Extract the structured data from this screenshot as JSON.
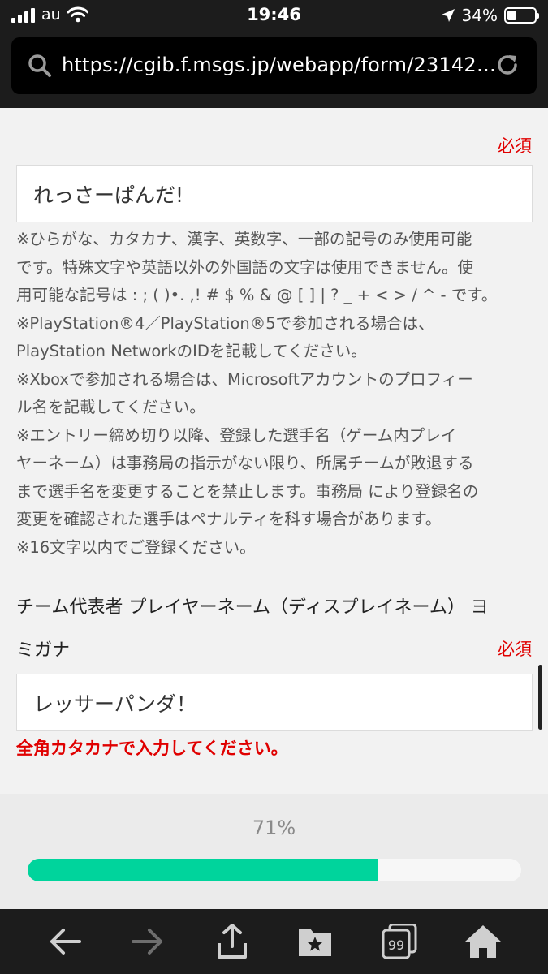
{
  "status_bar": {
    "carrier": "au",
    "time": "19:46",
    "battery": "34%",
    "battery_level": 0.34
  },
  "browser": {
    "url": "https://cgib.f.msgs.jp/webapp/form/23142_..."
  },
  "form": {
    "player_name": {
      "required_label": "必須",
      "value": "れっさーぱんだ!",
      "notes": [
        "※ひらがな、カタカナ、漢字、英数字、一部の記号のみ使用可能",
        "です。特殊文字や英語以外の外国語の文字は使用できません。使",
        "用可能な記号は : ; ( )•. ,! # $ % & @ [ ] | ? _ + < > / ^ - です。",
        "※PlayStation®4／PlayStation®5で参加される場合は、",
        "PlayStation NetworkのIDを記載してください。",
        "※Xboxで参加される場合は、Microsoftアカウントのプロフィー",
        "ル名を記載してください。",
        "※エントリー締め切り以降、登録した選手名（ゲーム内プレイ",
        "ヤーネーム）は事務局の指示がない限り、所属チームが敗退する",
        "まで選手名を変更することを禁止します。事務局 により登録名の",
        "変更を確認された選手はペナルティを科す場合があります。",
        "※16文字以内でご登録ください。"
      ]
    },
    "player_name_kana": {
      "label_line1": "チーム代表者 プレイヤーネーム（ディスプレイネーム） ヨ",
      "label_line2": "ミガナ",
      "required_label": "必須",
      "value": "レッサーパンダ！",
      "error": "全角カタカナで入力してください。"
    }
  },
  "progress": {
    "label": "71%",
    "value": 0.71
  },
  "colors": {
    "required": "#e00000",
    "progress_fill": "#00d49c"
  },
  "toolbar": {
    "icons": [
      "back-arrow-icon",
      "forward-arrow-icon",
      "share-icon",
      "bookmarks-icon",
      "tabs-icon",
      "home-icon"
    ],
    "tab_count": "99"
  }
}
